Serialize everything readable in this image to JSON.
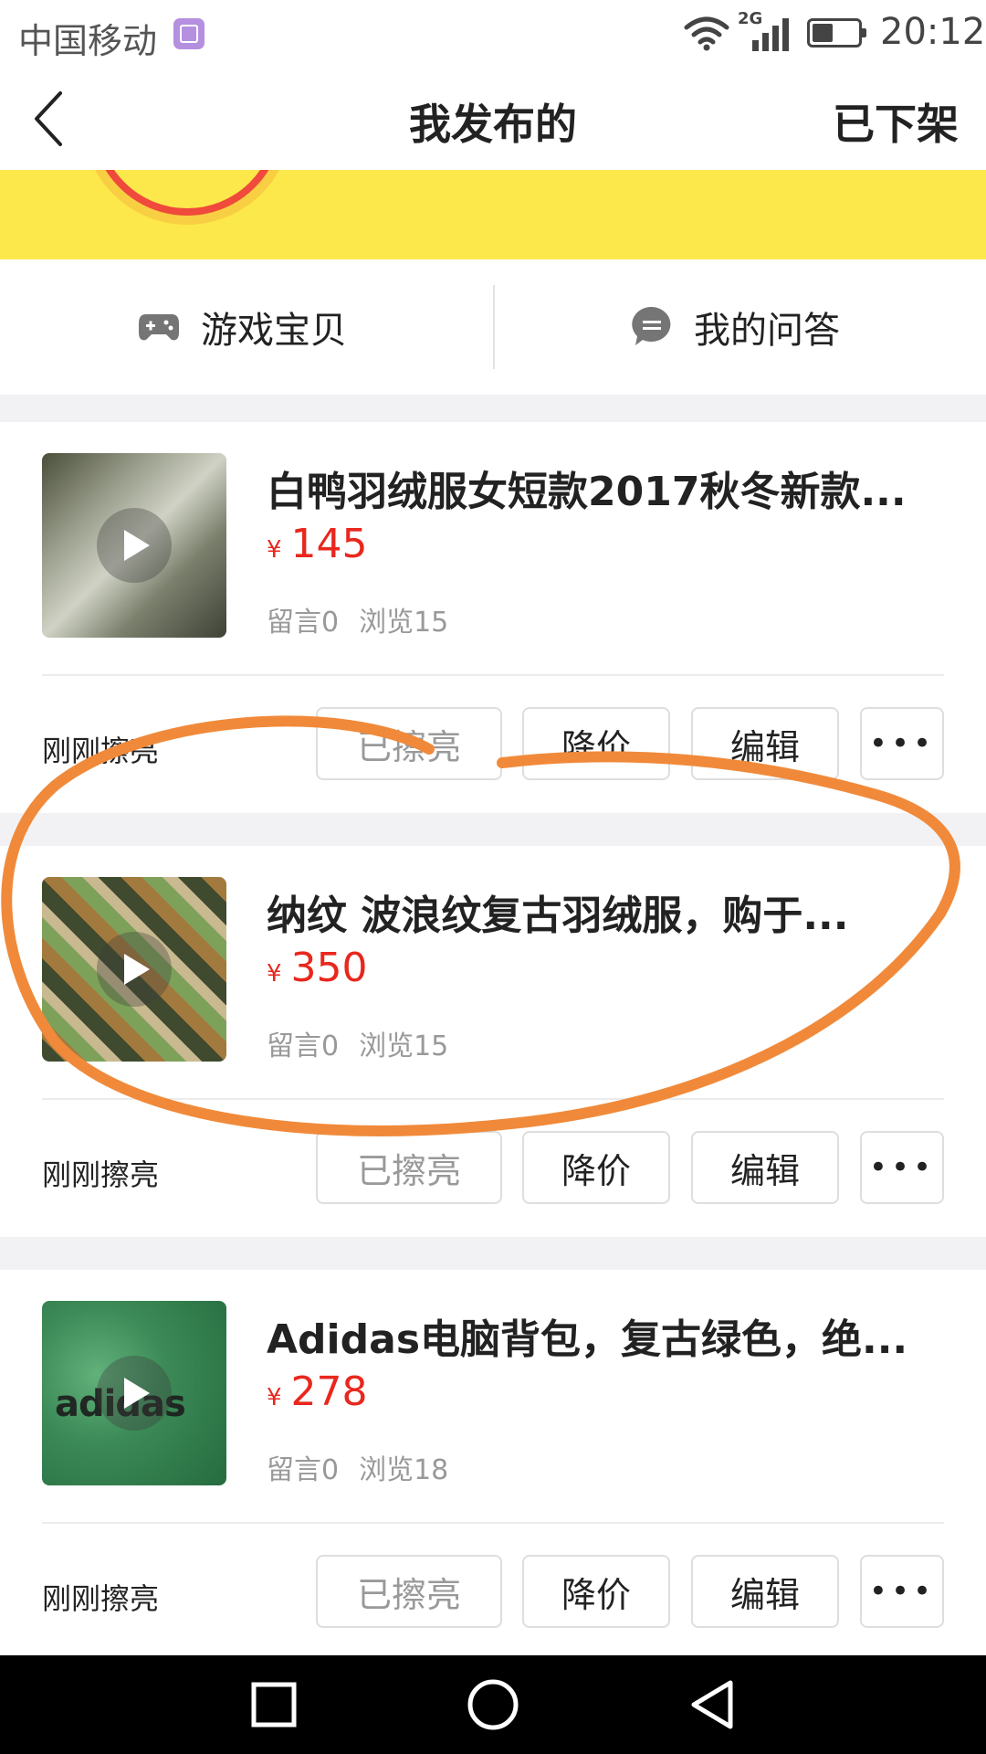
{
  "status_bar": {
    "carrier": "中国移动",
    "network": "2G",
    "time": "20:12"
  },
  "header": {
    "title": "我发布的",
    "right_link": "已下架"
  },
  "tabs": [
    {
      "label": "游戏宝贝",
      "icon": "gamepad-icon"
    },
    {
      "label": "我的问答",
      "icon": "chat-bubble-icon"
    }
  ],
  "items": [
    {
      "title": "白鸭羽绒服女短款2017秋冬新款...",
      "currency": "¥",
      "price": "145",
      "comments": "留言0",
      "views": "浏览15",
      "polish_status": "刚刚擦亮",
      "buttons": {
        "polished": "已擦亮",
        "reduce": "降价",
        "edit": "编辑"
      }
    },
    {
      "title": "纳纹 波浪纹复古羽绒服，购于...",
      "currency": "¥",
      "price": "350",
      "comments": "留言0",
      "views": "浏览15",
      "polish_status": "刚刚擦亮",
      "buttons": {
        "polished": "已擦亮",
        "reduce": "降价",
        "edit": "编辑"
      }
    },
    {
      "title": "Adidas电脑背包，复古绿色，绝...",
      "thumb_mark": "adidas",
      "currency": "¥",
      "price": "278",
      "comments": "留言0",
      "views": "浏览18",
      "polish_status": "刚刚擦亮",
      "buttons": {
        "polished": "已擦亮",
        "reduce": "降价",
        "edit": "编辑"
      }
    }
  ],
  "colors": {
    "price": "#e8271d",
    "banner": "#fde84b",
    "annotation": "#f08a3a"
  }
}
